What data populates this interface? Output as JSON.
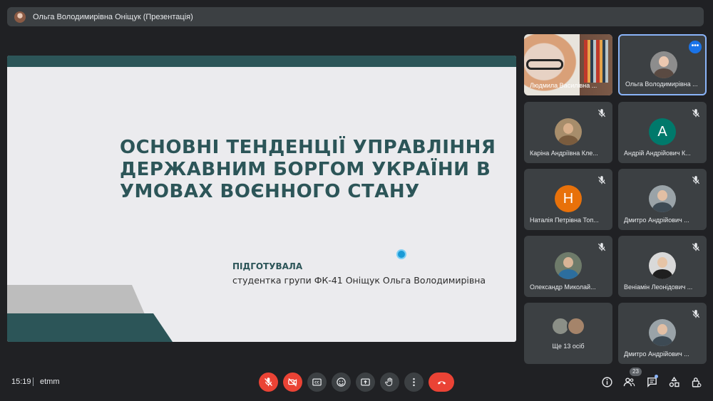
{
  "meeting": {
    "presenter_title": "Ольга Володимирівна Оніщук (Презентація)",
    "time": "15:19",
    "code": "etmm",
    "participants_count": "23"
  },
  "slide": {
    "heading_line1": "ОСНОВНІ ТЕНДЕНЦІЇ УПРАВЛІННЯ",
    "heading_line2": "ДЕРЖАВНИМ БОРГОМ УКРАЇНИ В",
    "heading_line3": "УМОВАХ ВОЄННОГО СТАНУ",
    "prepared_label": "ПІДГОТУВАЛА",
    "student_line": "студентка групи ФК-41 Оніщук Ольга Володимирівна"
  },
  "tiles": [
    {
      "name": "Людмила Василівна ..."
    },
    {
      "name": "Ольга Володимирівна ..."
    },
    {
      "name": "Каріна Андріївна Кле..."
    },
    {
      "name": "Андрій Андрійович К...",
      "initial": "A"
    },
    {
      "name": "Наталія Петрівна Топ...",
      "initial": "Н"
    },
    {
      "name": "Дмитро Андрійович ..."
    },
    {
      "name": "Олександр Миколай..."
    },
    {
      "name": "Веніамін Леонідович ..."
    },
    {
      "name": "Ще 13 осіб"
    },
    {
      "name": "Дмитро Андрійович ..."
    }
  ],
  "colors": {
    "slide_accent": "#2c5558",
    "danger": "#ea4335",
    "active_border": "#8ab4f8",
    "avatar_teal": "#00796b",
    "avatar_orange": "#e8710a"
  }
}
